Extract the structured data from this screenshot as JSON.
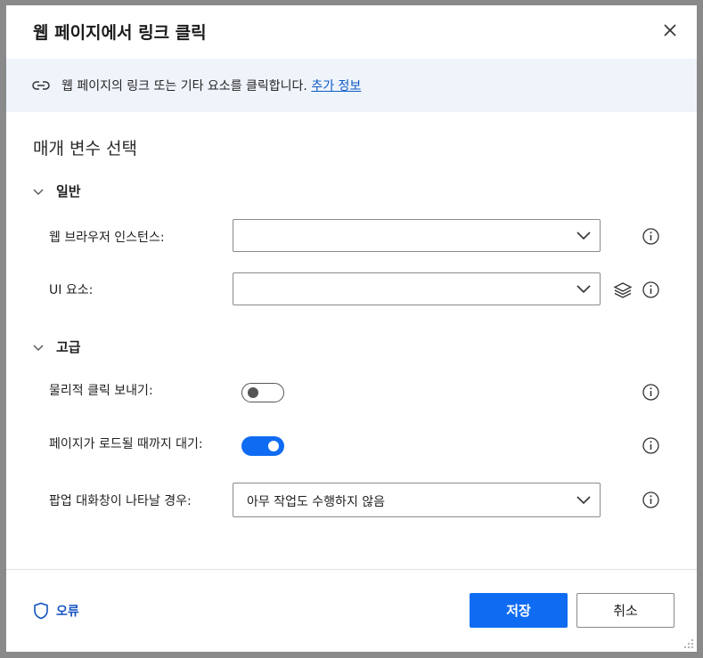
{
  "dialog": {
    "title": "웹 페이지에서 링크 클릭",
    "close_icon": "close-icon"
  },
  "info": {
    "text": "웹 페이지의 링크 또는 기타 요소를 클릭합니다.",
    "link": "추가 정보",
    "icon": "link-icon"
  },
  "section_title": "매개 변수 선택",
  "groups": {
    "general": "일반",
    "advanced": "고급"
  },
  "fields": {
    "browser_instance": {
      "label": "웹 브라우저 인스턴스:",
      "value": ""
    },
    "ui_element": {
      "label": "UI 요소:",
      "value": ""
    },
    "physical_click": {
      "label": "물리적 클릭 보내기:",
      "on": false
    },
    "wait_page_load": {
      "label": "페이지가 로드될 때까지 대기:",
      "on": true
    },
    "popup_dialog": {
      "label": "팝업 대화창이 나타날 경우:",
      "value": "아무 작업도 수행하지 않음"
    }
  },
  "footer": {
    "error_label": "오류",
    "save_label": "저장",
    "cancel_label": "취소"
  },
  "colors": {
    "accent": "#0f6cf2",
    "link": "#0f58c6",
    "info_bar_bg": "#eff4fb"
  }
}
